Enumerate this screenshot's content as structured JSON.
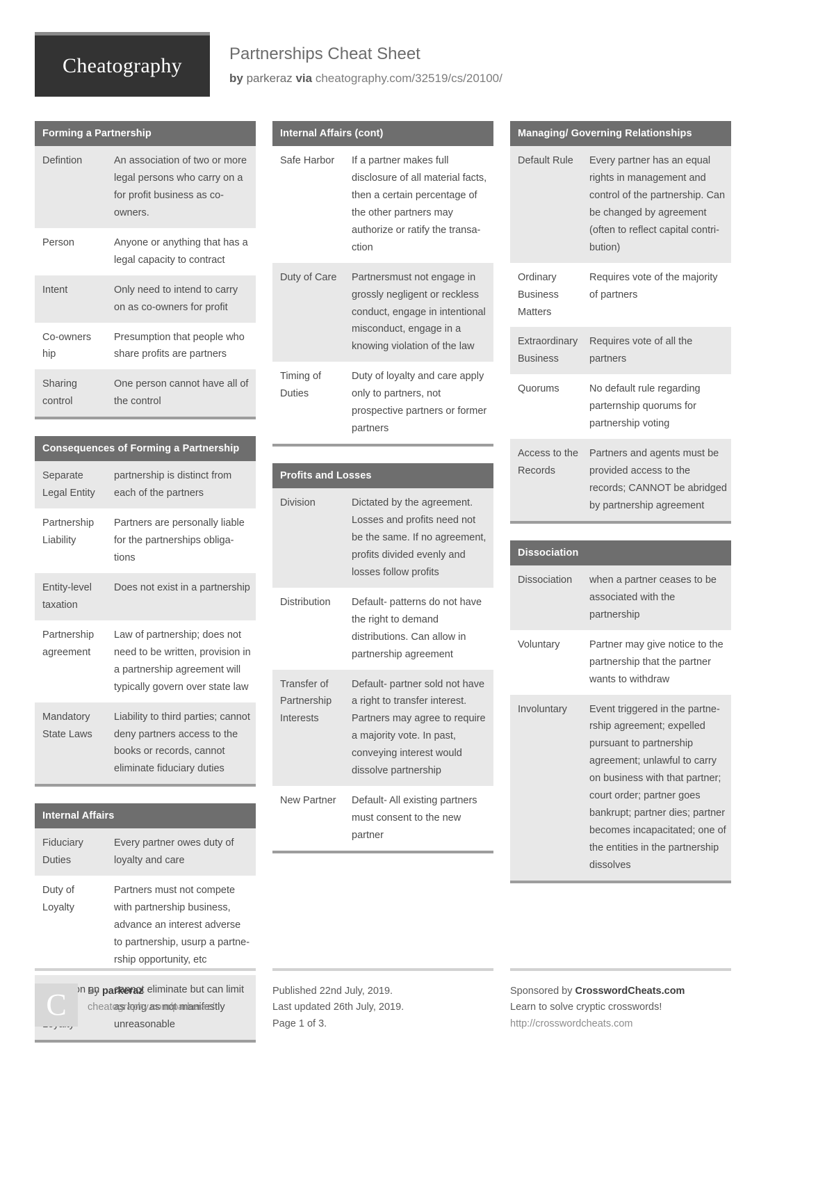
{
  "header": {
    "logo_text": "Cheatography",
    "title": "Partnerships Cheat Sheet",
    "by_label": "by",
    "author": "parkeraz",
    "via_label": "via",
    "source_url": "cheatography.com/32519/cs/20100/"
  },
  "columns": [
    {
      "blocks": [
        {
          "title": "Forming a Partnership",
          "rows": [
            {
              "key": "Defintion",
              "value": "An association of two or more legal persons who carry on a for profit business as co-owners."
            },
            {
              "key": "Person",
              "value": "Anyone or anything that has a legal capacity to contract"
            },
            {
              "key": "Intent",
              "value": "Only need to intend to carry on as co-owners for profit"
            },
            {
              "key": "Co-own­ers​hip",
              "value": "Presumption that people who share profits are partners"
            },
            {
              "key": "Sharing control",
              "value": "One person cannot have all of the control"
            }
          ]
        },
        {
          "title": "Consequences of Forming a Partnership",
          "rows": [
            {
              "key": "Separate Legal Entity",
              "value": "partnership is distinct from each of the partners"
            },
            {
              "key": "Partne­rship Liability",
              "value": "Partners are personally liable for the partnerships obliga­tions"
            },
            {
              "key": "Entity-​level taxation",
              "value": "Does not exist in a partne­rship"
            },
            {
              "key": "Partne­rship agreement",
              "value": "Law of partnership; does not need to be written, provision in a partnership agreement will typically govern over state law"
            },
            {
              "key": "Mandatory State Laws",
              "value": "Liability to third parties; cannot deny partners access to the books or records, cannot eliminate fiduciary duties"
            }
          ]
        },
        {
          "title": "Internal Affairs",
          "rows": [
            {
              "key": "Fiduciary Duties",
              "value": "Every partner owes duty of loyalty and care"
            },
            {
              "key": "Duty of Loyalty",
              "value": "Partners must not compete with partnership business, advance an interest adverse to partnership, usurp a partne­rship opportunity, etc"
            },
            {
              "key": "Limitation on Duty of Loyalty",
              "value": "cannot eliminate but can limit as long as not manifestly unreasonable"
            }
          ]
        }
      ]
    },
    {
      "blocks": [
        {
          "title": "Internal Affairs (cont)",
          "rows": [
            {
              "key": "Safe Harbor",
              "value": "If a partner makes full disclosure of all material facts, then a certain percentage of the other partners may authorize or ratify the transa­ction"
            },
            {
              "key": "Duty of Care",
              "value": "Partnersmust not engage in grossly negligent or reckless conduct, engage in intentional misconduct, engage in a knowing violation of the law"
            },
            {
              "key": "Timing of Duties",
              "value": "Duty of loyalty and care apply only to partners, not prospective partners or former partners"
            }
          ]
        },
        {
          "title": "Profits and Losses",
          "rows": [
            {
              "key": "Division",
              "value": "Dictated by the agreement. Losses and profits need not be the same. If no agreement, profits divided evenly and losses follow profits"
            },
            {
              "key": "Distri­bution",
              "value": "Default- patterns do not have the right to demand distributions. Can allow in partnership agreement"
            },
            {
              "key": "Transfer of Partne­rship Interests",
              "value": "Default- partner sold not have a right to transfer interest. Partners may agree to require a majority vote. In past, conveying interest would dissolve partne­rship"
            },
            {
              "key": "New Partner",
              "value": "Default- All existing partners must consent to the new partner"
            }
          ]
        }
      ]
    },
    {
      "blocks": [
        {
          "title": "Managing/ Governing Relationships",
          "rows": [
            {
              "key": "Default Rule",
              "value": "Every partner has an equal rights in management and control of the partnership. Can be changed by agreement (often to reflect capital contri­bution)"
            },
            {
              "key": "Ordinary Business Matters",
              "value": "Requires vote of the majority of partners"
            },
            {
              "key": "Extrao­rdinary Business",
              "value": "Requires vote of all the partners"
            },
            {
              "key": "Quorums",
              "value": "No default rule regarding parternship quorums for partne­rship voting"
            },
            {
              "key": "Access to the Records",
              "value": "Partners and agents must be provided access to the records; CANNOT be abridged by partnership agreement"
            }
          ]
        },
        {
          "title": "Dissociation",
          "rows": [
            {
              "key": "Dissoc­iation",
              "value": "when a partner ceases to be associated with the partnership"
            },
            {
              "key": "Voluntary",
              "value": "Partner may give notice to the partnership that the partner wants to withdraw"
            },
            {
              "key": "Involu­ntary",
              "value": "Event triggered in the partne­rship agreement; expelled pursuant to partnership agreement; unlawful to carry on business with that partner; court order; partner goes bankrupt; partner dies; partner becomes incapacitated; one of the entities in the partnership dissolves"
            }
          ]
        }
      ]
    }
  ],
  "footer": {
    "author_icon_letter": "C",
    "by_label": "By",
    "author": "parkeraz",
    "author_url": "cheatography.com/parkeraz/",
    "published": "Published 22nd July, 2019.",
    "last_updated": "Last updated 26th July, 2019.",
    "page": "Page 1 of 3.",
    "sponsor_prefix": "Sponsored by",
    "sponsor_name": "CrosswordCheats.com",
    "sponsor_tagline": "Learn to solve cryptic crosswords!",
    "sponsor_url": "http://crosswordcheats.com"
  }
}
